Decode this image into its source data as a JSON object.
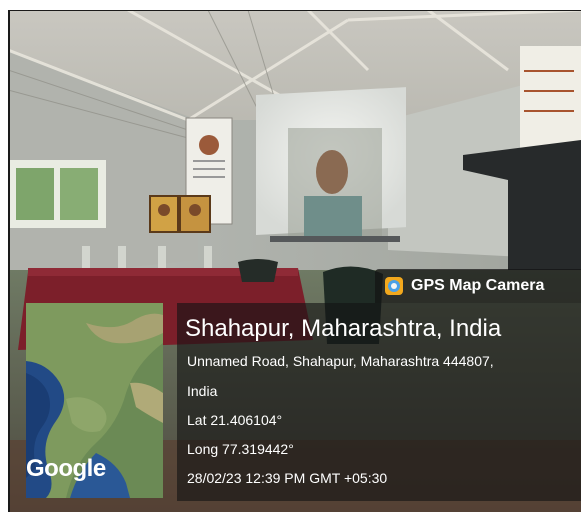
{
  "badge": {
    "label": "GPS Map Camera",
    "icon": "gps-map-camera-icon"
  },
  "location": {
    "title": "Shahapur, Maharashtra, India",
    "address_line1": "Unnamed Road, Shahapur, Maharashtra 444807,",
    "address_line2": "India",
    "latitude": "Lat 21.406104°",
    "longitude": "Long 77.319442°",
    "timestamp": "28/02/23 12:39 PM GMT +05:30"
  },
  "map": {
    "provider_label": "Google"
  },
  "colors": {
    "overlay": "#141414",
    "text": "#ffffff",
    "badge_icon": "#f2a81d"
  }
}
